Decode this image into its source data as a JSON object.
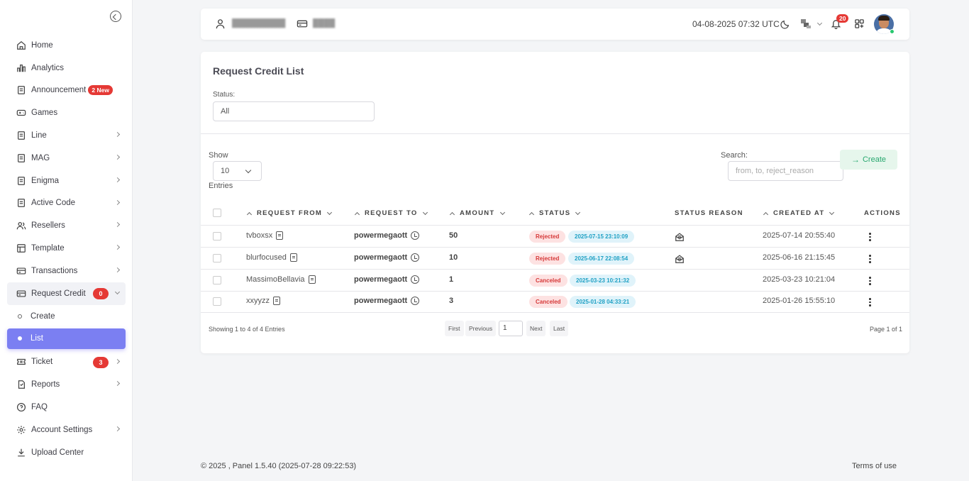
{
  "sidebar": {
    "items": [
      {
        "label": "Home",
        "icon": "home-icon"
      },
      {
        "label": "Analytics",
        "icon": "bar-chart-icon"
      },
      {
        "label": "Announcement",
        "icon": "document-icon",
        "badge": "2 New"
      },
      {
        "label": "Games",
        "icon": "gamepad-icon"
      },
      {
        "label": "Line",
        "icon": "document-icon"
      },
      {
        "label": "MAG",
        "icon": "document-icon"
      },
      {
        "label": "Enigma",
        "icon": "document-icon"
      },
      {
        "label": "Active Code",
        "icon": "document-icon"
      },
      {
        "label": "Resellers",
        "icon": "users-icon"
      },
      {
        "label": "Template",
        "icon": "template-icon"
      },
      {
        "label": "Transactions",
        "icon": "card-icon"
      },
      {
        "label": "Request Credit",
        "icon": "card-icon",
        "badge": "0"
      },
      {
        "label": "Create",
        "icon": "circle-icon"
      },
      {
        "label": "List",
        "icon": "circle-icon"
      },
      {
        "label": "Ticket",
        "icon": "ticket-icon",
        "badge": "3"
      },
      {
        "label": "Reports",
        "icon": "report-icon"
      },
      {
        "label": "FAQ",
        "icon": "question-icon"
      },
      {
        "label": "Account Settings",
        "icon": "gear-icon"
      },
      {
        "label": "Upload Center",
        "icon": "download-icon"
      }
    ]
  },
  "topbar": {
    "datetime": "04-08-2025 07:32 UTC",
    "notifications": "20",
    "user_blurred": "██████████",
    "balance_blurred": "████"
  },
  "page": {
    "title": "Request Credit List",
    "status_label": "Status:",
    "status_value": "All",
    "show_label": "Show",
    "entries_value": "10",
    "entries_label": "Entries",
    "search_label": "Search:",
    "search_placeholder": "from, to, reject_reason",
    "create_label": "Create"
  },
  "table": {
    "columns": [
      "REQUEST FROM",
      "REQUEST TO",
      "AMOUNT",
      "STATUS",
      "STATUS REASON",
      "CREATED AT",
      "ACTIONS"
    ],
    "rows": [
      {
        "from": "tvboxsx",
        "to": "powermegaott",
        "amount": "50",
        "status": "Rejected",
        "status_date": "2025-07-15 23:10:09",
        "has_reason": true,
        "created": "2025-07-14 20:55:40"
      },
      {
        "from": "blurfocused",
        "to": "powermegaott",
        "amount": "10",
        "status": "Rejected",
        "status_date": "2025-06-17 22:08:54",
        "has_reason": true,
        "created": "2025-06-16 21:15:45"
      },
      {
        "from": "MassimoBellavia",
        "to": "powermegaott",
        "amount": "1",
        "status": "Canceled",
        "status_date": "2025-03-23 10:21:32",
        "has_reason": false,
        "created": "2025-03-23 10:21:04"
      },
      {
        "from": "xxyyzz",
        "to": "powermegaott",
        "amount": "3",
        "status": "Canceled",
        "status_date": "2025-01-28 04:33:21",
        "has_reason": false,
        "created": "2025-01-26 15:55:10"
      }
    ]
  },
  "pagination": {
    "showing": "Showing 1 to 4 of 4 Entries",
    "first": "First",
    "previous": "Previous",
    "page_input": "1",
    "next": "Next",
    "last": "Last",
    "page_of": "Page 1 of 1"
  },
  "footer": {
    "copyright": "© 2025 , Panel 1.5.40 (2025-07-28 09:22:53)",
    "terms": "Terms of use"
  },
  "colors": {
    "accent": "#7b7ff2",
    "danger": "#e53935",
    "success": "#28a76f",
    "info": "#1ea0c4"
  }
}
